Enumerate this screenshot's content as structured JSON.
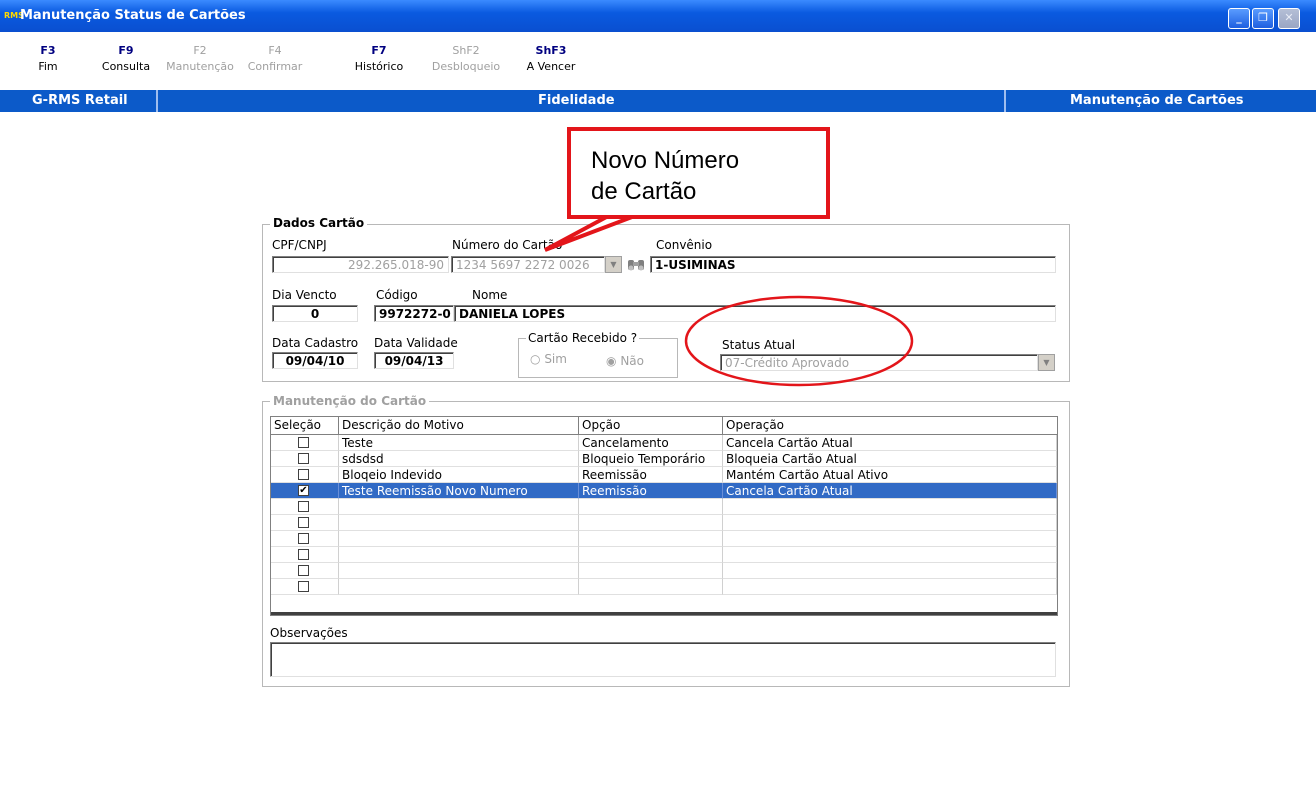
{
  "window": {
    "title": "Manutenção Status de Cartões",
    "app_icon_text": "RMS",
    "buttons": {
      "minimize": "_",
      "restore": "❐",
      "close": "✕"
    }
  },
  "toolbar": {
    "keys": [
      {
        "key": "F3",
        "label": "Fim",
        "enabled": true
      },
      {
        "key": "F9",
        "label": "Consulta",
        "enabled": true
      },
      {
        "key": "F2",
        "label": "Manutenção",
        "enabled": false
      },
      {
        "key": "F4",
        "label": "Confirmar",
        "enabled": false
      },
      {
        "key": "F7",
        "label": "Histórico",
        "enabled": true
      },
      {
        "key": "ShF2",
        "label": "Desbloqueio",
        "enabled": false
      },
      {
        "key": "ShF3",
        "label": "A Vencer",
        "enabled": true
      }
    ]
  },
  "header": {
    "left": "G-RMS Retail",
    "center": "Fidelidade",
    "right": "Manutenção de Cartões"
  },
  "annotation": {
    "callout_line1": "Novo Número",
    "callout_line2": "de Cartão",
    "color": "#e3151a"
  },
  "dados_cartao": {
    "group_label": "Dados Cartão",
    "cpf_label": "CPF/CNPJ",
    "cpf_value": "292.265.018-90",
    "numero_label": "Número do Cartão",
    "numero_value": "1234 5697 2272 0026",
    "convenio_label": "Convênio",
    "convenio_value": "1-USIMINAS",
    "dia_vencto_label": "Dia Vencto",
    "dia_vencto_value": "0",
    "codigo_label": "Código",
    "codigo_value": "9972272-0",
    "nome_label": "Nome",
    "nome_value": "DANIELA LOPES",
    "data_cadastro_label": "Data Cadastro",
    "data_cadastro_value": "09/04/10",
    "data_validade_label": "Data Validade",
    "data_validade_value": "09/04/13",
    "cartao_recebido_label": "Cartão Recebido ?",
    "radio_sim": "Sim",
    "radio_nao": "Não",
    "radio_selected": "Não",
    "status_label": "Status Atual",
    "status_value": "07-Crédito Aprovado"
  },
  "manutencao": {
    "group_label": "Manutenção do Cartão",
    "columns": [
      "Seleção",
      "Descrição do Motivo",
      "Opção",
      "Operação"
    ],
    "rows": [
      {
        "checked": false,
        "descricao": "Teste",
        "opcao": "Cancelamento",
        "operacao": "Cancela Cartão Atual"
      },
      {
        "checked": false,
        "descricao": "sdsdsd",
        "opcao": "Bloqueio Temporário",
        "operacao": "Bloqueia Cartão Atual"
      },
      {
        "checked": false,
        "descricao": "Bloqeio Indevido",
        "opcao": "Reemissão",
        "operacao": "Mantém Cartão Atual Ativo"
      },
      {
        "checked": true,
        "descricao": "Teste Reemissão Novo Numero",
        "opcao": "Reemissão",
        "operacao": "Cancela Cartão Atual"
      },
      {
        "checked": false,
        "descricao": "",
        "opcao": "",
        "operacao": ""
      },
      {
        "checked": false,
        "descricao": "",
        "opcao": "",
        "operacao": ""
      },
      {
        "checked": false,
        "descricao": "",
        "opcao": "",
        "operacao": ""
      },
      {
        "checked": false,
        "descricao": "",
        "opcao": "",
        "operacao": ""
      },
      {
        "checked": false,
        "descricao": "",
        "opcao": "",
        "operacao": ""
      },
      {
        "checked": false,
        "descricao": "",
        "opcao": "",
        "operacao": ""
      }
    ],
    "selected_row": 3,
    "observacoes_label": "Observações",
    "observacoes_value": ""
  }
}
